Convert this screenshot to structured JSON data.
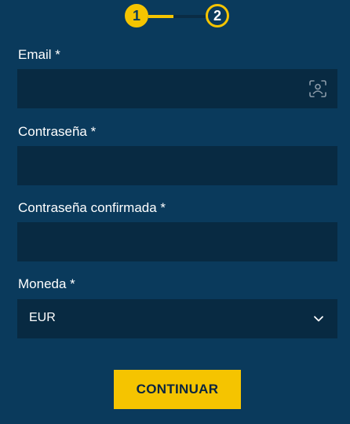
{
  "stepper": {
    "steps": [
      {
        "label": "1",
        "state": "active"
      },
      {
        "label": "2",
        "state": "pending"
      }
    ],
    "progress": 0.5,
    "accent_color": "#f5c400"
  },
  "form": {
    "email": {
      "label": "Email *",
      "value": "",
      "icon": "contact-card-icon"
    },
    "password": {
      "label": "Contraseña *",
      "value": ""
    },
    "password_confirm": {
      "label": "Contraseña confirmada *",
      "value": ""
    },
    "currency": {
      "label": "Moneda *",
      "value": "EUR",
      "icon": "chevron-down-icon"
    }
  },
  "actions": {
    "continue_label": "CONTINUAR"
  },
  "colors": {
    "background": "#0a3a5c",
    "field_background": "#082a42",
    "button": "#f5c400"
  }
}
